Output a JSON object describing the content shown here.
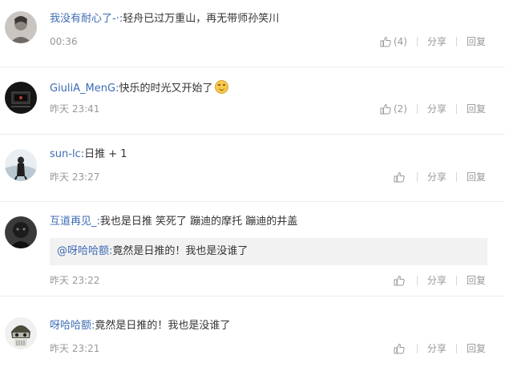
{
  "comments": [
    {
      "username": "我没有耐心了-·:",
      "text": "轻舟已过万重山，再无带师孙笑川",
      "time": "00:36",
      "like_count": "(4)",
      "share_label": "分享",
      "reply_label": "回复"
    },
    {
      "username": "GiuliA_MenG:",
      "text": "快乐的时光又开始了",
      "emoji": "smile-emoji",
      "time": "昨天 23:41",
      "like_count": "(2)",
      "share_label": "分享",
      "reply_label": "回复"
    },
    {
      "username": "sun-lc:",
      "text": "日推 + 1",
      "time": "昨天 23:27",
      "like_count": "",
      "share_label": "分享",
      "reply_label": "回复"
    },
    {
      "username": "互道再见_:",
      "text": "我也是日推 笑死了 蹦迪的摩托 蹦迪的井盖",
      "quote": {
        "username": "@呀哈哈额:",
        "text": "竟然是日推的！我也是没谁了"
      },
      "time": "昨天 23:22",
      "like_count": "",
      "share_label": "分享",
      "reply_label": "回复"
    },
    {
      "username": "呀哈哈额:",
      "text": "竟然是日推的！我也是没谁了",
      "time": "昨天 23:21",
      "like_count": "",
      "share_label": "分享",
      "reply_label": "回复"
    }
  ],
  "colors": {
    "username": "#3d6bb3",
    "text": "#333333",
    "meta": "#999999",
    "quote_bg": "#f2f2f2"
  }
}
